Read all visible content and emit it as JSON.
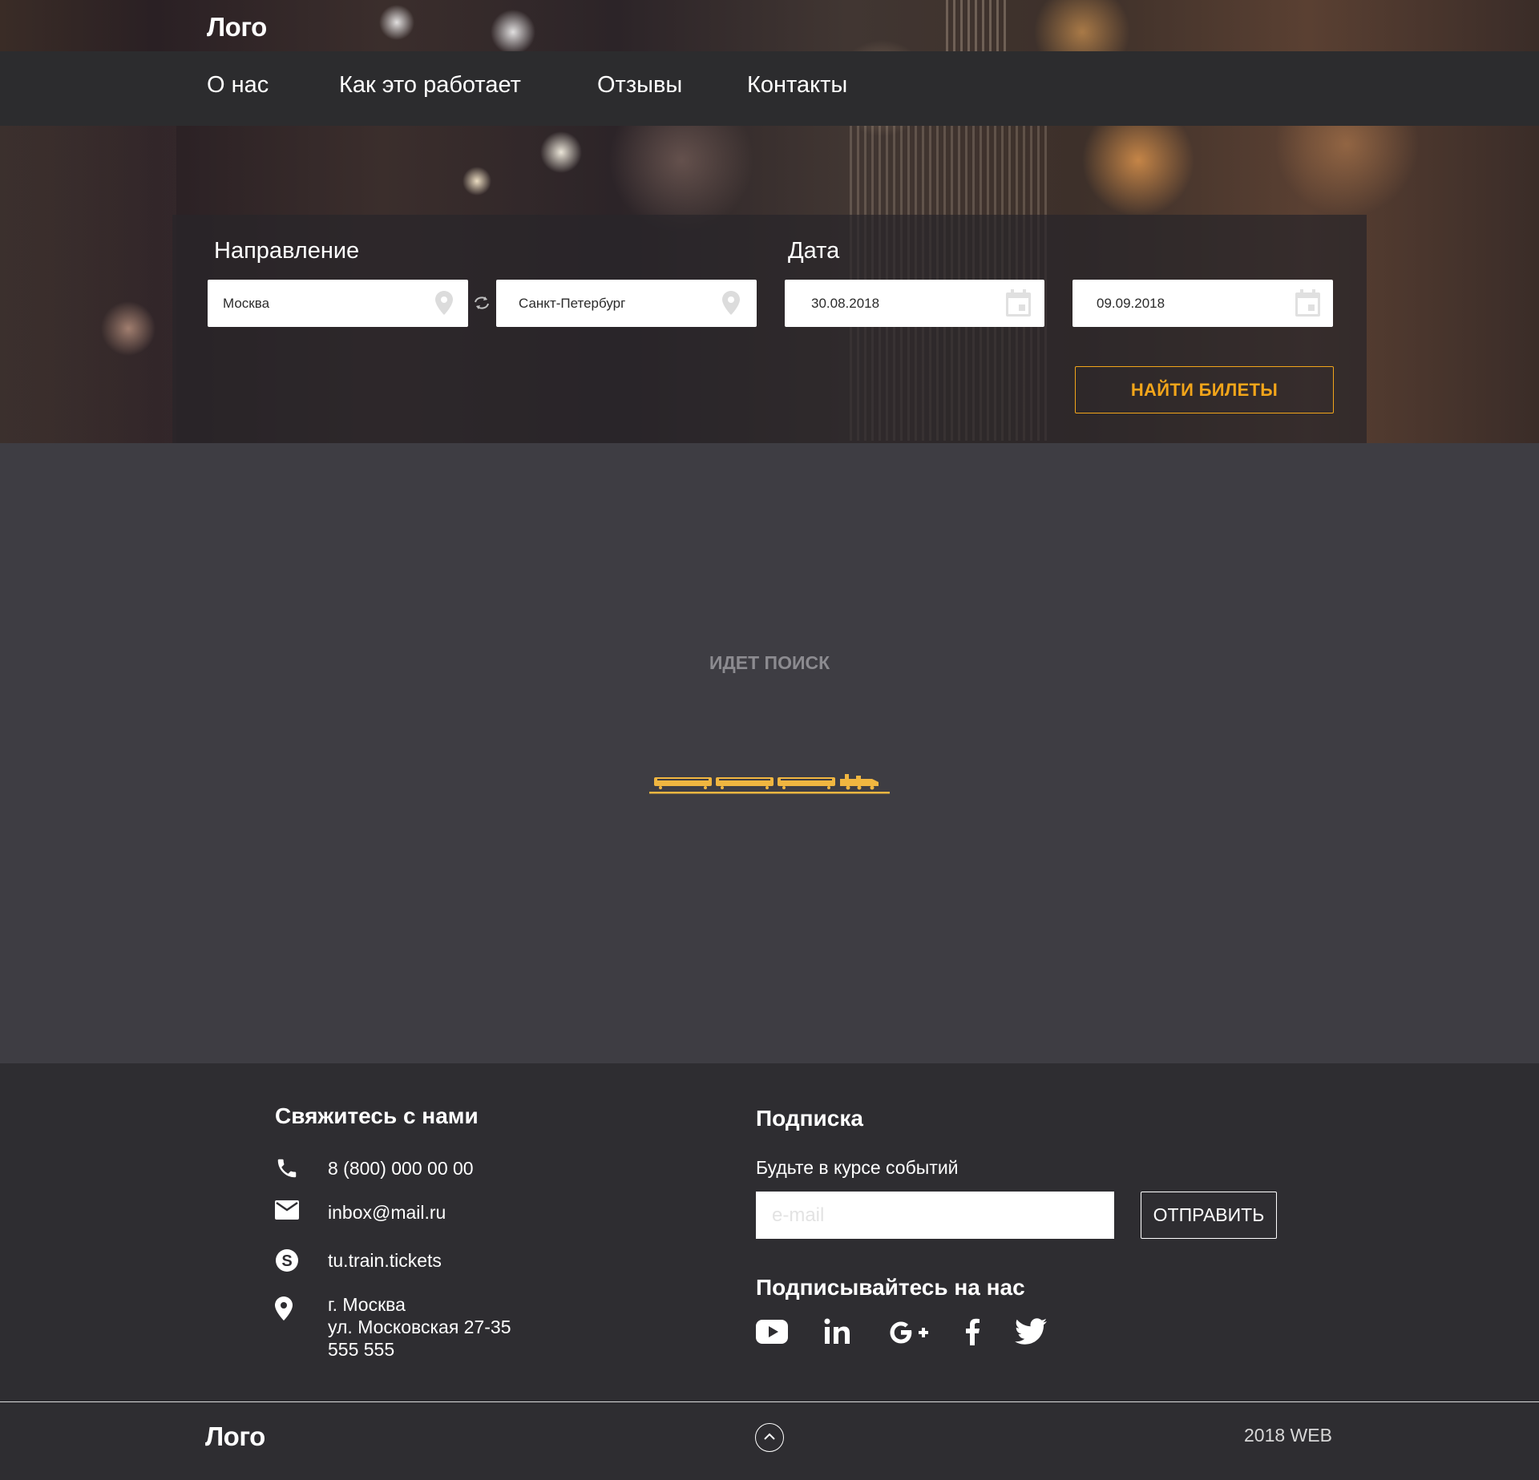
{
  "header": {
    "logo": "Лого",
    "nav": [
      {
        "label": "О нас"
      },
      {
        "label": "Как это работает"
      },
      {
        "label": "Отзывы"
      },
      {
        "label": "Контакты"
      }
    ]
  },
  "search": {
    "direction_label": "Направление",
    "date_label": "Дата",
    "from": {
      "value": "Москва",
      "icon": "location-pin-icon"
    },
    "to": {
      "value": "Санкт-Петербург",
      "icon": "location-pin-icon"
    },
    "swap_icon": "swap-arrows-icon",
    "date_from": {
      "value": "30.08.2018",
      "icon": "calendar-icon"
    },
    "date_to": {
      "value": "09.09.2018",
      "icon": "calendar-icon"
    },
    "find_button": "НАЙТИ БИЛЕТЫ"
  },
  "status": {
    "searching_text": "ИДЕТ ПОИСК",
    "loader_icon": "train-loader-icon"
  },
  "footer": {
    "contacts_title": "Свяжитесь с нами",
    "phone": "8 (800) 000 00 00",
    "email": "inbox@mail.ru",
    "skype": "tu.train.tickets",
    "address_lines": [
      "г. Москва",
      "ул. Московская 27-35",
      "555 555"
    ],
    "subscribe_title": "Подписка",
    "subscribe_text": "Будьте в курсе событий",
    "email_placeholder": "e-mail",
    "send_button": "ОТПРАВИТЬ",
    "follow_title": "Подписывайтесь на нас",
    "social_icons": [
      "youtube-icon",
      "linkedin-icon",
      "google-plus-icon",
      "facebook-icon",
      "twitter-icon"
    ],
    "logo": "Лого",
    "copyright": "2018 WEB"
  },
  "colors": {
    "accent": "#f2a51a",
    "navbar": "#2c2c2e",
    "main_bg": "#3e3d43",
    "footer_bg": "#2e2d31"
  }
}
